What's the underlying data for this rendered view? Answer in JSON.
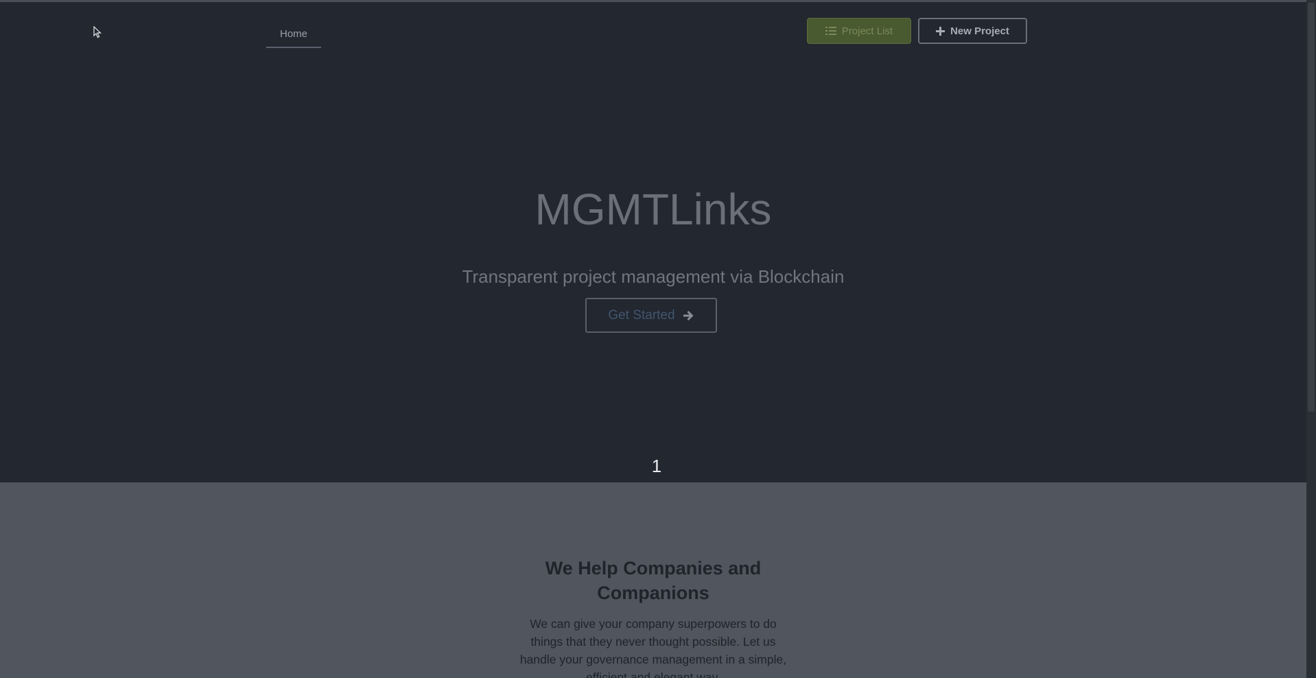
{
  "nav": {
    "home_label": "Home"
  },
  "header": {
    "project_list_label": "Project List",
    "new_project_label": "New Project"
  },
  "hero": {
    "title": "MGMTLinks",
    "subtitle": "Transparent project management via Blockchain",
    "cta_label": "Get Started"
  },
  "slider": {
    "current_slide": "1"
  },
  "section": {
    "title_line1": "We Help Companies and",
    "title_line2": "Companions",
    "text_line1": "We can give your company superpowers to do",
    "text_line2": "things that they never thought possible. Let us",
    "text_line3": "handle your governance management in a simple,",
    "text_line4": "efficient and elegant way."
  },
  "colors": {
    "hero_bg": "#222730",
    "section_bg": "#50555e",
    "project_list_bg": "#4a5a30",
    "accent_text": "#42556e"
  },
  "icons": {
    "list_icon": "list-icon",
    "plus_icon": "plus-icon",
    "arrow_right_icon": "arrow-right-icon",
    "cursor_icon": "mouse-cursor-icon"
  }
}
